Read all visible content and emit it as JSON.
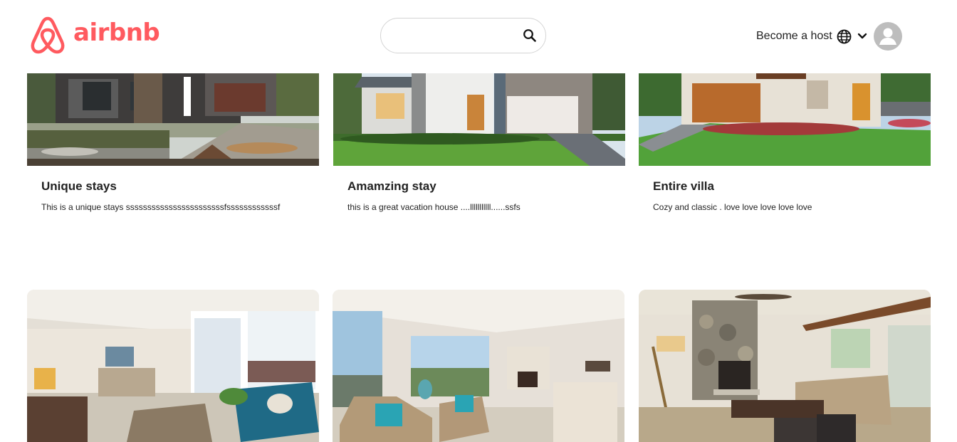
{
  "brand": {
    "name": "airbnb",
    "color": "#ff5a5f",
    "logo_icon": "airbnb-belo-icon"
  },
  "search": {
    "value": "",
    "placeholder": "",
    "icon": "search-icon"
  },
  "nav": {
    "become_host": "Become a host",
    "globe_icon": "globe-icon",
    "menu_icon": "chevron-down-icon",
    "avatar_icon": "user-avatar-icon"
  },
  "listings": [
    {
      "title": "Unique stays",
      "description": "This is a unique stays sssssssssssssssssssssssfssssssssssssf"
    },
    {
      "title": "Amamzing stay",
      "description": "this is a great vacation house ....lllllllllll......ssfs"
    },
    {
      "title": "Entire villa",
      "description": "Cozy and classic . love love love love love"
    }
  ],
  "gallery": [
    {
      "scene": "open-plan-living-room-photo"
    },
    {
      "scene": "living-room-with-view-photo"
    },
    {
      "scene": "stone-fireplace-living-room-photo"
    }
  ]
}
